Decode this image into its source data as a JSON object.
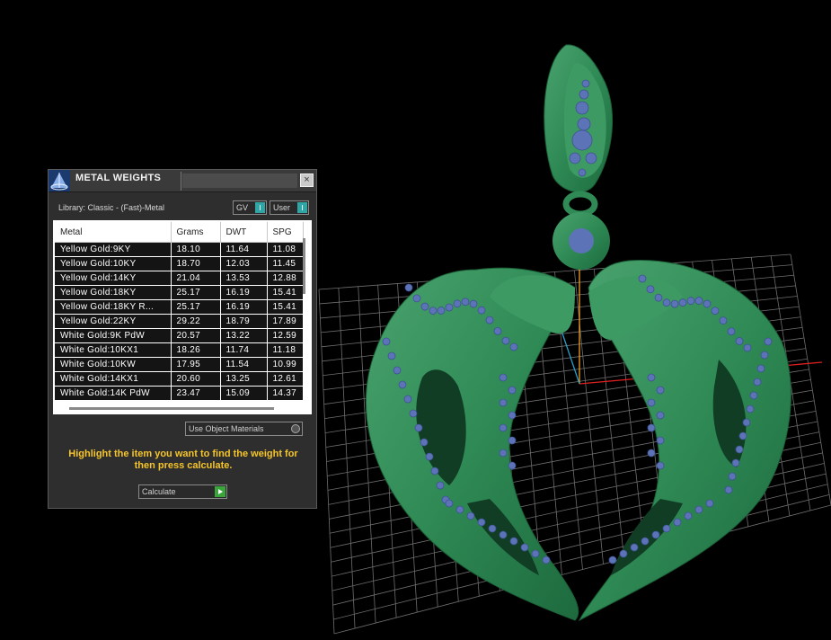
{
  "dialog": {
    "title": "METAL WEIGHTS",
    "close_label": "×",
    "library_label": "Library: Classic - (Fast)-Metal",
    "gv_label": "GV",
    "user_label": "User",
    "columns": [
      "Metal",
      "Grams",
      "DWT",
      "SPG"
    ],
    "rows": [
      [
        "Yellow Gold:9KY",
        "18.10",
        "11.64",
        "11.08"
      ],
      [
        "Yellow Gold:10KY",
        "18.70",
        "12.03",
        "11.45"
      ],
      [
        "Yellow Gold:14KY",
        "21.04",
        "13.53",
        "12.88"
      ],
      [
        "Yellow Gold:18KY",
        "25.17",
        "16.19",
        "15.41"
      ],
      [
        "Yellow Gold:18KY R...",
        "25.17",
        "16.19",
        "15.41"
      ],
      [
        "Yellow Gold:22KY",
        "29.22",
        "18.79",
        "17.89"
      ],
      [
        "White Gold:9K PdW",
        "20.57",
        "13.22",
        "12.59"
      ],
      [
        "White Gold:10KX1",
        "18.26",
        "11.74",
        "11.18"
      ],
      [
        "White Gold:10KW",
        "17.95",
        "11.54",
        "10.99"
      ],
      [
        "White Gold:14KX1",
        "20.60",
        "13.25",
        "12.61"
      ],
      [
        "White Gold:14K PdW",
        "23.47",
        "15.09",
        "14.37"
      ]
    ],
    "use_materials_label": "Use Object Materials",
    "hint": "Highlight the item you want to find the weight for then press calculate.",
    "calculate_label": "Calculate"
  },
  "colors": {
    "viewport_bg": "#000000",
    "model_green": "#2f8a55",
    "gem_blue": "#5d73b8",
    "hint_yellow": "#f5c52a",
    "accent_teal": "#2fa5a5"
  }
}
